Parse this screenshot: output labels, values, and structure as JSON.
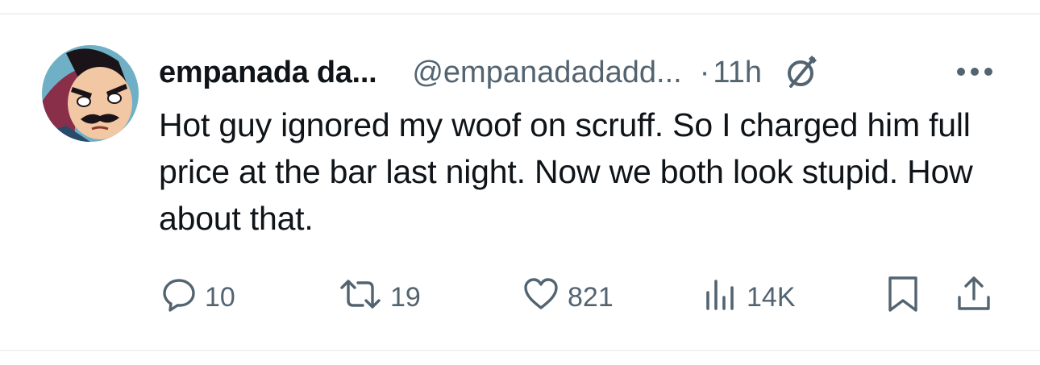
{
  "tweet": {
    "display_name": "empanada da...",
    "handle": "@empanadadadd...",
    "separator": "·",
    "time": "11h",
    "text": "Hot guy ignored my woof on scruff. So I charged him full price at the bar last night. Now we both look stupid. How about that."
  },
  "actions": {
    "replies": "10",
    "retweets": "19",
    "likes": "821",
    "views": "14K"
  },
  "icons": {
    "edited": "edited-pencil-icon",
    "more": "more-icon",
    "reply": "reply-icon",
    "retweet": "retweet-icon",
    "like": "heart-icon",
    "views": "views-icon",
    "bookmark": "bookmark-icon",
    "share": "share-icon"
  },
  "colors": {
    "text": "#0f1419",
    "secondary": "#536471",
    "divider": "#eff3f4"
  }
}
